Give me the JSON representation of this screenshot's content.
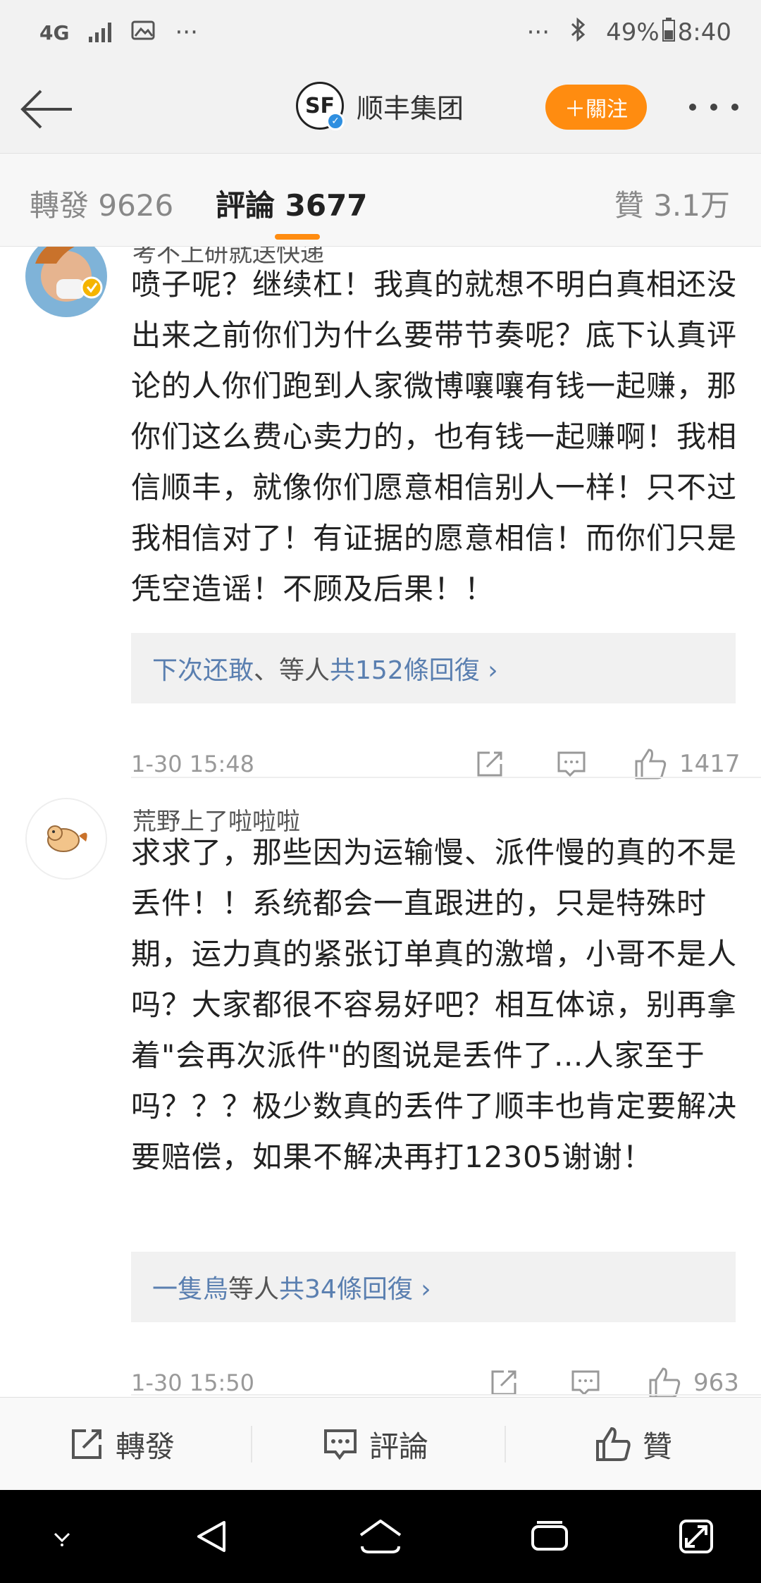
{
  "status_bar": {
    "network": "4G",
    "dots_left": "···",
    "dots_right": "···",
    "battery": "49%",
    "time": "8:40"
  },
  "nav": {
    "logo_text": "SF",
    "title": "顺丰集团",
    "follow_label": "＋關注"
  },
  "tabs": {
    "repost": "轉發 9626",
    "comment": "評論 3677",
    "like": "贊 3.1万"
  },
  "comments": [
    {
      "username": "考不上研就送快递",
      "text": "喷子呢？继续杠！我真的就想不明白真相还没出来之前你们为什么要带节奏呢？底下认真评论的人你们跑到人家微博嚷嚷有钱一起赚，那你们这么费心卖力的，也有钱一起赚啊！我相信顺丰，就像你们愿意相信别人一样！只不过我相信对了！有证据的愿意相信！而你们只是凭空造谣！不顾及后果！！",
      "reply_user": "下次还敢",
      "reply_sep": "、等人",
      "reply_count": " 共152條回復 ›",
      "time": "1-30 15:48",
      "likes": "1417"
    },
    {
      "username": "荒野上了啦啦啦",
      "text": "求求了，那些因为运输慢、派件慢的真的不是丢件！！系统都会一直跟进的，只是特殊时期，运力真的紧张订单真的激增，小哥不是人吗？大家都很不容易好吧？相互体谅，别再拿着\"会再次派件\"的图说是丢件了…人家至于吗？？？极少数真的丢件了顺丰也肯定要解决要赔偿，如果不解决再打12305谢谢！",
      "reply_user": "一隻鳥",
      "reply_sep": "等人",
      "reply_count": " 共34條回復 ›",
      "time": "1-30 15:50",
      "likes": "963"
    }
  ],
  "bottom_bar": {
    "repost": "轉發",
    "comment": "評論",
    "like": "贊"
  },
  "colors": {
    "accent": "#ff8c10",
    "link": "#5a7fb0",
    "verified": "#2f8fe0"
  }
}
